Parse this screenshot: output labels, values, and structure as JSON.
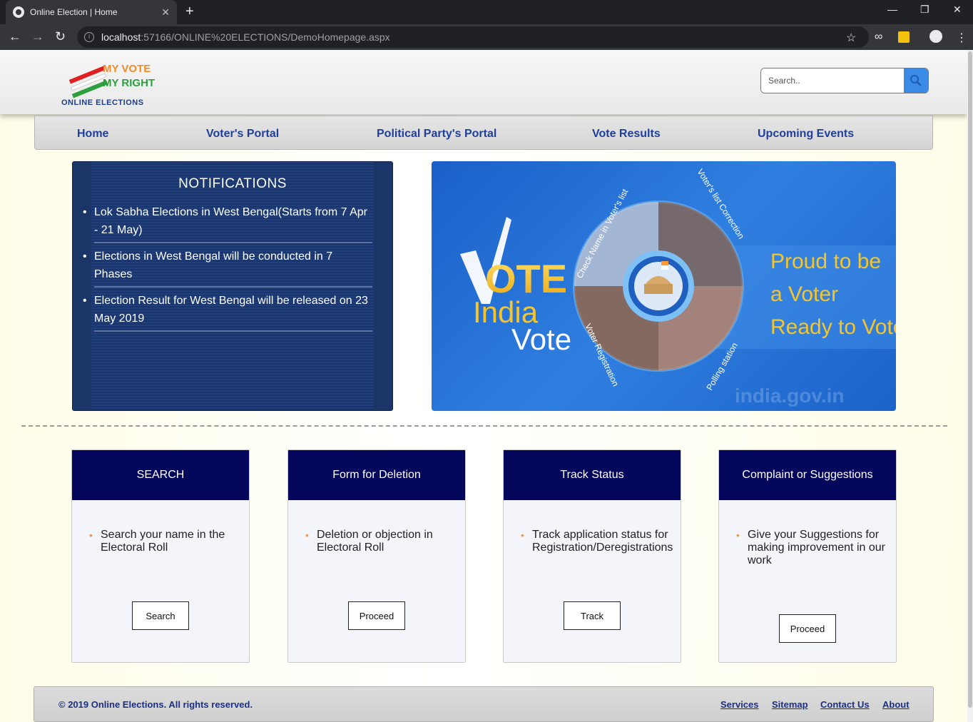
{
  "browser": {
    "tab_title": "Online Election | Home",
    "url_host": "localhost",
    "url_rest": ":57166/ONLINE%20ELECTIONS/DemoHomepage.aspx"
  },
  "header": {
    "logo_line1": "MY VOTE",
    "logo_line2": "MY RIGHT",
    "logo_line3": "ONLINE ELECTIONS",
    "search_placeholder": "Search.."
  },
  "nav": {
    "items": [
      "Home",
      "Voter's Portal",
      "Political Party's Portal",
      "Vote Results",
      "Upcoming Events"
    ]
  },
  "notifications": {
    "title": "NOTIFICATIONS",
    "items": [
      "Lok Sabha Elections in West Bengal(Starts from 7 Apr - 21 May)",
      "Elections in West Bengal will be conducted in 7 Phases",
      "Election Result for West Bengal will be released on 23 May 2019"
    ]
  },
  "banner": {
    "vote_word": "OTE",
    "india_word": "India",
    "vote2_word": "Vote",
    "tagline1": "Proud to be",
    "tagline2": "a Voter",
    "tagline3": "Ready to Vote",
    "ring_top_left": "Check Name in Voter's list",
    "ring_top_right": "Voter's list Correction",
    "ring_bottom_left": "Voter Registration",
    "ring_bottom_right": "Polling station",
    "watermark": "india.gov.in"
  },
  "cards": [
    {
      "title": "SEARCH",
      "text": "Search your name in the Electoral Roll",
      "button": "Search"
    },
    {
      "title": "Form for Deletion",
      "text": "Deletion or objection in Electoral Roll",
      "button": "Proceed"
    },
    {
      "title": "Track Status",
      "text": "Track application status for Registration/Deregistrations",
      "button": "Track"
    },
    {
      "title": "Complaint or Suggestions",
      "text": "Give your Suggestions for making improvement in our work",
      "button": "Proceed"
    }
  ],
  "footer": {
    "copyright": "© 2019 Online Elections. All rights reserved.",
    "links": [
      "Services",
      "Sitemap",
      "Contact Us",
      "About"
    ]
  },
  "colors": {
    "nav_text": "#1f3f9b",
    "card_header": "#04065c",
    "bullet": "#f29b38",
    "search_button": "#3b8ae6"
  }
}
